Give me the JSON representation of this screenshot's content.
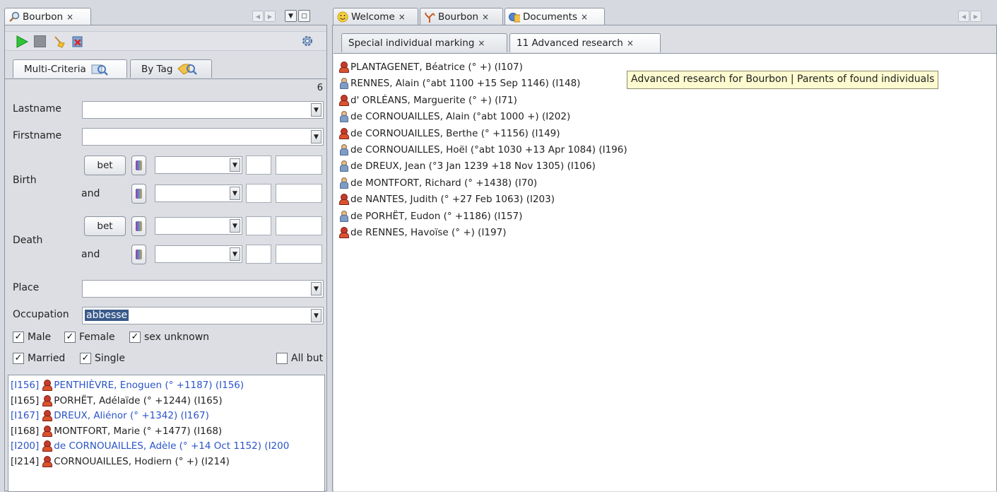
{
  "left_panel": {
    "tab_label": "Bourbon",
    "toolbar": {
      "run": "play-icon",
      "stop": "stop-icon",
      "clear": "broom-icon",
      "clear_results": "delete-results-icon",
      "settings": "settings-icon"
    },
    "subtabs": [
      {
        "label": "Multi-Criteria",
        "icon": "search-icon",
        "active": true
      },
      {
        "label": "By Tag",
        "icon": "tag-search-icon",
        "active": false
      }
    ],
    "result_count": "6",
    "form": {
      "lastname_label": "Lastname",
      "firstname_label": "Firstname",
      "birth_label": "Birth",
      "death_label": "Death",
      "bet_label": "bet",
      "and_label": "and",
      "place_label": "Place",
      "occupation_label": "Occupation",
      "occupation_value": "abbesse"
    },
    "checks": {
      "male": "Male",
      "female": "Female",
      "sex_unknown": "sex unknown",
      "married": "Married",
      "single": "Single",
      "all_but": "All but"
    },
    "results": [
      {
        "id": "[I156]",
        "name": "PENTHIÈVRE, Enoguen (° +1187) (I156)",
        "highlight": true
      },
      {
        "id": "[I165]",
        "name": "PORHËT, Adélaïde (° +1244) (I165)",
        "highlight": false
      },
      {
        "id": "[I167]",
        "name": "DREUX, Aliénor (° +1342) (I167)",
        "highlight": true
      },
      {
        "id": "[I168]",
        "name": "MONTFORT, Marie (° +1477) (I168)",
        "highlight": false
      },
      {
        "id": "[I200]",
        "name": "de CORNOUAILLES, Adèle (° +14 Oct 1152) (I200",
        "highlight": true
      },
      {
        "id": "[I214]",
        "name": "CORNOUAILLES, Hodiern (° +) (I214)",
        "highlight": false
      }
    ]
  },
  "right_panel": {
    "tabs": [
      {
        "label": "Welcome",
        "icon": "smiley-icon"
      },
      {
        "label": "Bourbon",
        "icon": "tree-icon"
      },
      {
        "label": "Documents",
        "icon": "documents-icon",
        "active": true
      }
    ],
    "subtabs": [
      {
        "label": "Special individual marking"
      },
      {
        "label": "11 Advanced research",
        "active": true
      }
    ],
    "tooltip": "Advanced research for Bourbon | Parents of found individuals",
    "individuals": [
      {
        "sex": "f",
        "text": "PLANTAGENET, Béatrice (° +) (I107)"
      },
      {
        "sex": "m",
        "text": "RENNES, Alain (°abt 1100 +15 Sep 1146) (I148)"
      },
      {
        "sex": "f",
        "text": "d' ORLÉANS, Marguerite (° +) (I71)"
      },
      {
        "sex": "m",
        "text": "de CORNOUAILLES, Alain (°abt 1000 +) (I202)"
      },
      {
        "sex": "f",
        "text": "de CORNOUAILLES, Berthe (° +1156) (I149)"
      },
      {
        "sex": "m",
        "text": "de CORNOUAILLES, Hoël (°abt 1030 +13 Apr 1084) (I196)"
      },
      {
        "sex": "m",
        "text": "de DREUX, Jean (°3 Jan 1239 +18 Nov 1305) (I106)"
      },
      {
        "sex": "m",
        "text": "de MONTFORT, Richard (° +1438) (I70)"
      },
      {
        "sex": "f",
        "text": "de NANTES, Judith (° +27 Feb 1063) (I203)"
      },
      {
        "sex": "m",
        "text": "de PORHËT, Eudon (° +1186) (I157)"
      },
      {
        "sex": "f",
        "text": "de RENNES, Havoïse (° +) (I197)"
      }
    ]
  },
  "colors": {
    "link_blue": "#2a54c9",
    "selection": "#39598a",
    "tooltip_bg": "#fdfbcf"
  }
}
